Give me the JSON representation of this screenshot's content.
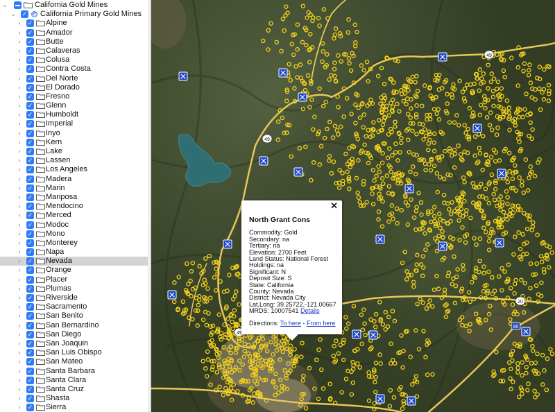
{
  "sidebar": {
    "root": {
      "label": "California Gold Mines"
    },
    "group": {
      "label": "California Primary Gold Mines"
    },
    "selected": "Nevada",
    "counties": [
      "Alpine",
      "Amador",
      "Butte",
      "Calaveras",
      "Colusa",
      "Contra Costa",
      "Del Norte",
      "El Dorado",
      "Fresno",
      "Glenn",
      "Humboldt",
      "Imperial",
      "Inyo",
      "Kern",
      "Lake",
      "Lassen",
      "Los Angeles",
      "Madera",
      "Marin",
      "Mariposa",
      "Mendocino",
      "Merced",
      "Modoc",
      "Mono",
      "Monterey",
      "Napa",
      "Nevada",
      "Orange",
      "Placer",
      "Plumas",
      "Riverside",
      "Sacramento",
      "San Benito",
      "San Bernardino",
      "San Diego",
      "San Joaquin",
      "San Luis Obispo",
      "San Mateo",
      "Santa Barbara",
      "Santa Clara",
      "Santa Cruz",
      "Shasta",
      "Sierra"
    ]
  },
  "map": {
    "road_shields": [
      "49",
      "49",
      "49",
      "20",
      "80"
    ],
    "colors": {
      "road": "#e6c75a",
      "mine_marker": "#f5d31c",
      "water": "#2f6f74",
      "icon_bg": "#1f48c9"
    }
  },
  "popup": {
    "title": "North Grant Cons",
    "fields": [
      "Commodity: Gold",
      "Secondary: na",
      "Tertiary: na",
      "Elevation: 2700 Feet",
      "Land Status: National Forest",
      "Holdings: na",
      "Significant: N",
      "Deposit Size: S",
      "State: California",
      "County: Nevada",
      "District: Nevada City",
      "Lat,Long: 39.25722,-121.00667"
    ],
    "mrds_label": "MRDS: 10007541",
    "details_link": "Details",
    "directions_label": "Directions:",
    "to_here": "To here",
    "separator": "-",
    "from_here": "From here",
    "close": "✕"
  }
}
